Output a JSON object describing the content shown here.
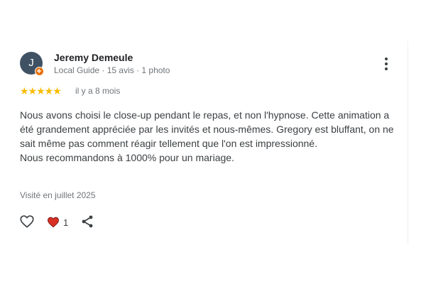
{
  "review": {
    "author": {
      "initial": "J",
      "name": "Jeremy Demeule",
      "meta": "Local Guide · 15 avis · 1 photo"
    },
    "rating": {
      "stars": "★★★★★",
      "value": 5,
      "max": 5,
      "date": "il y a 8 mois"
    },
    "text": "Nous avons choisi le close-up pendant le repas, et non l'hypnose. Cette animation a été grandement appréciée par les invités et nous-mêmes. Gregory est bluffant, on ne sait même pas comment réagir tellement que l'on est impressionné.\nNous recommandons à 1000% pour un mariage.",
    "visited": "Visité en juillet 2025",
    "reactions": {
      "count": "1"
    }
  },
  "icons": {
    "more": "more-vert-icon",
    "like": "heart-outline-icon",
    "reaction": "heart-filled-icon",
    "share": "share-icon",
    "badge": "local-guide-badge-icon"
  },
  "colors": {
    "star": "#fbbc04",
    "avatar": "#3f5263",
    "badge": "#e8710a",
    "heart": "#d93025"
  }
}
